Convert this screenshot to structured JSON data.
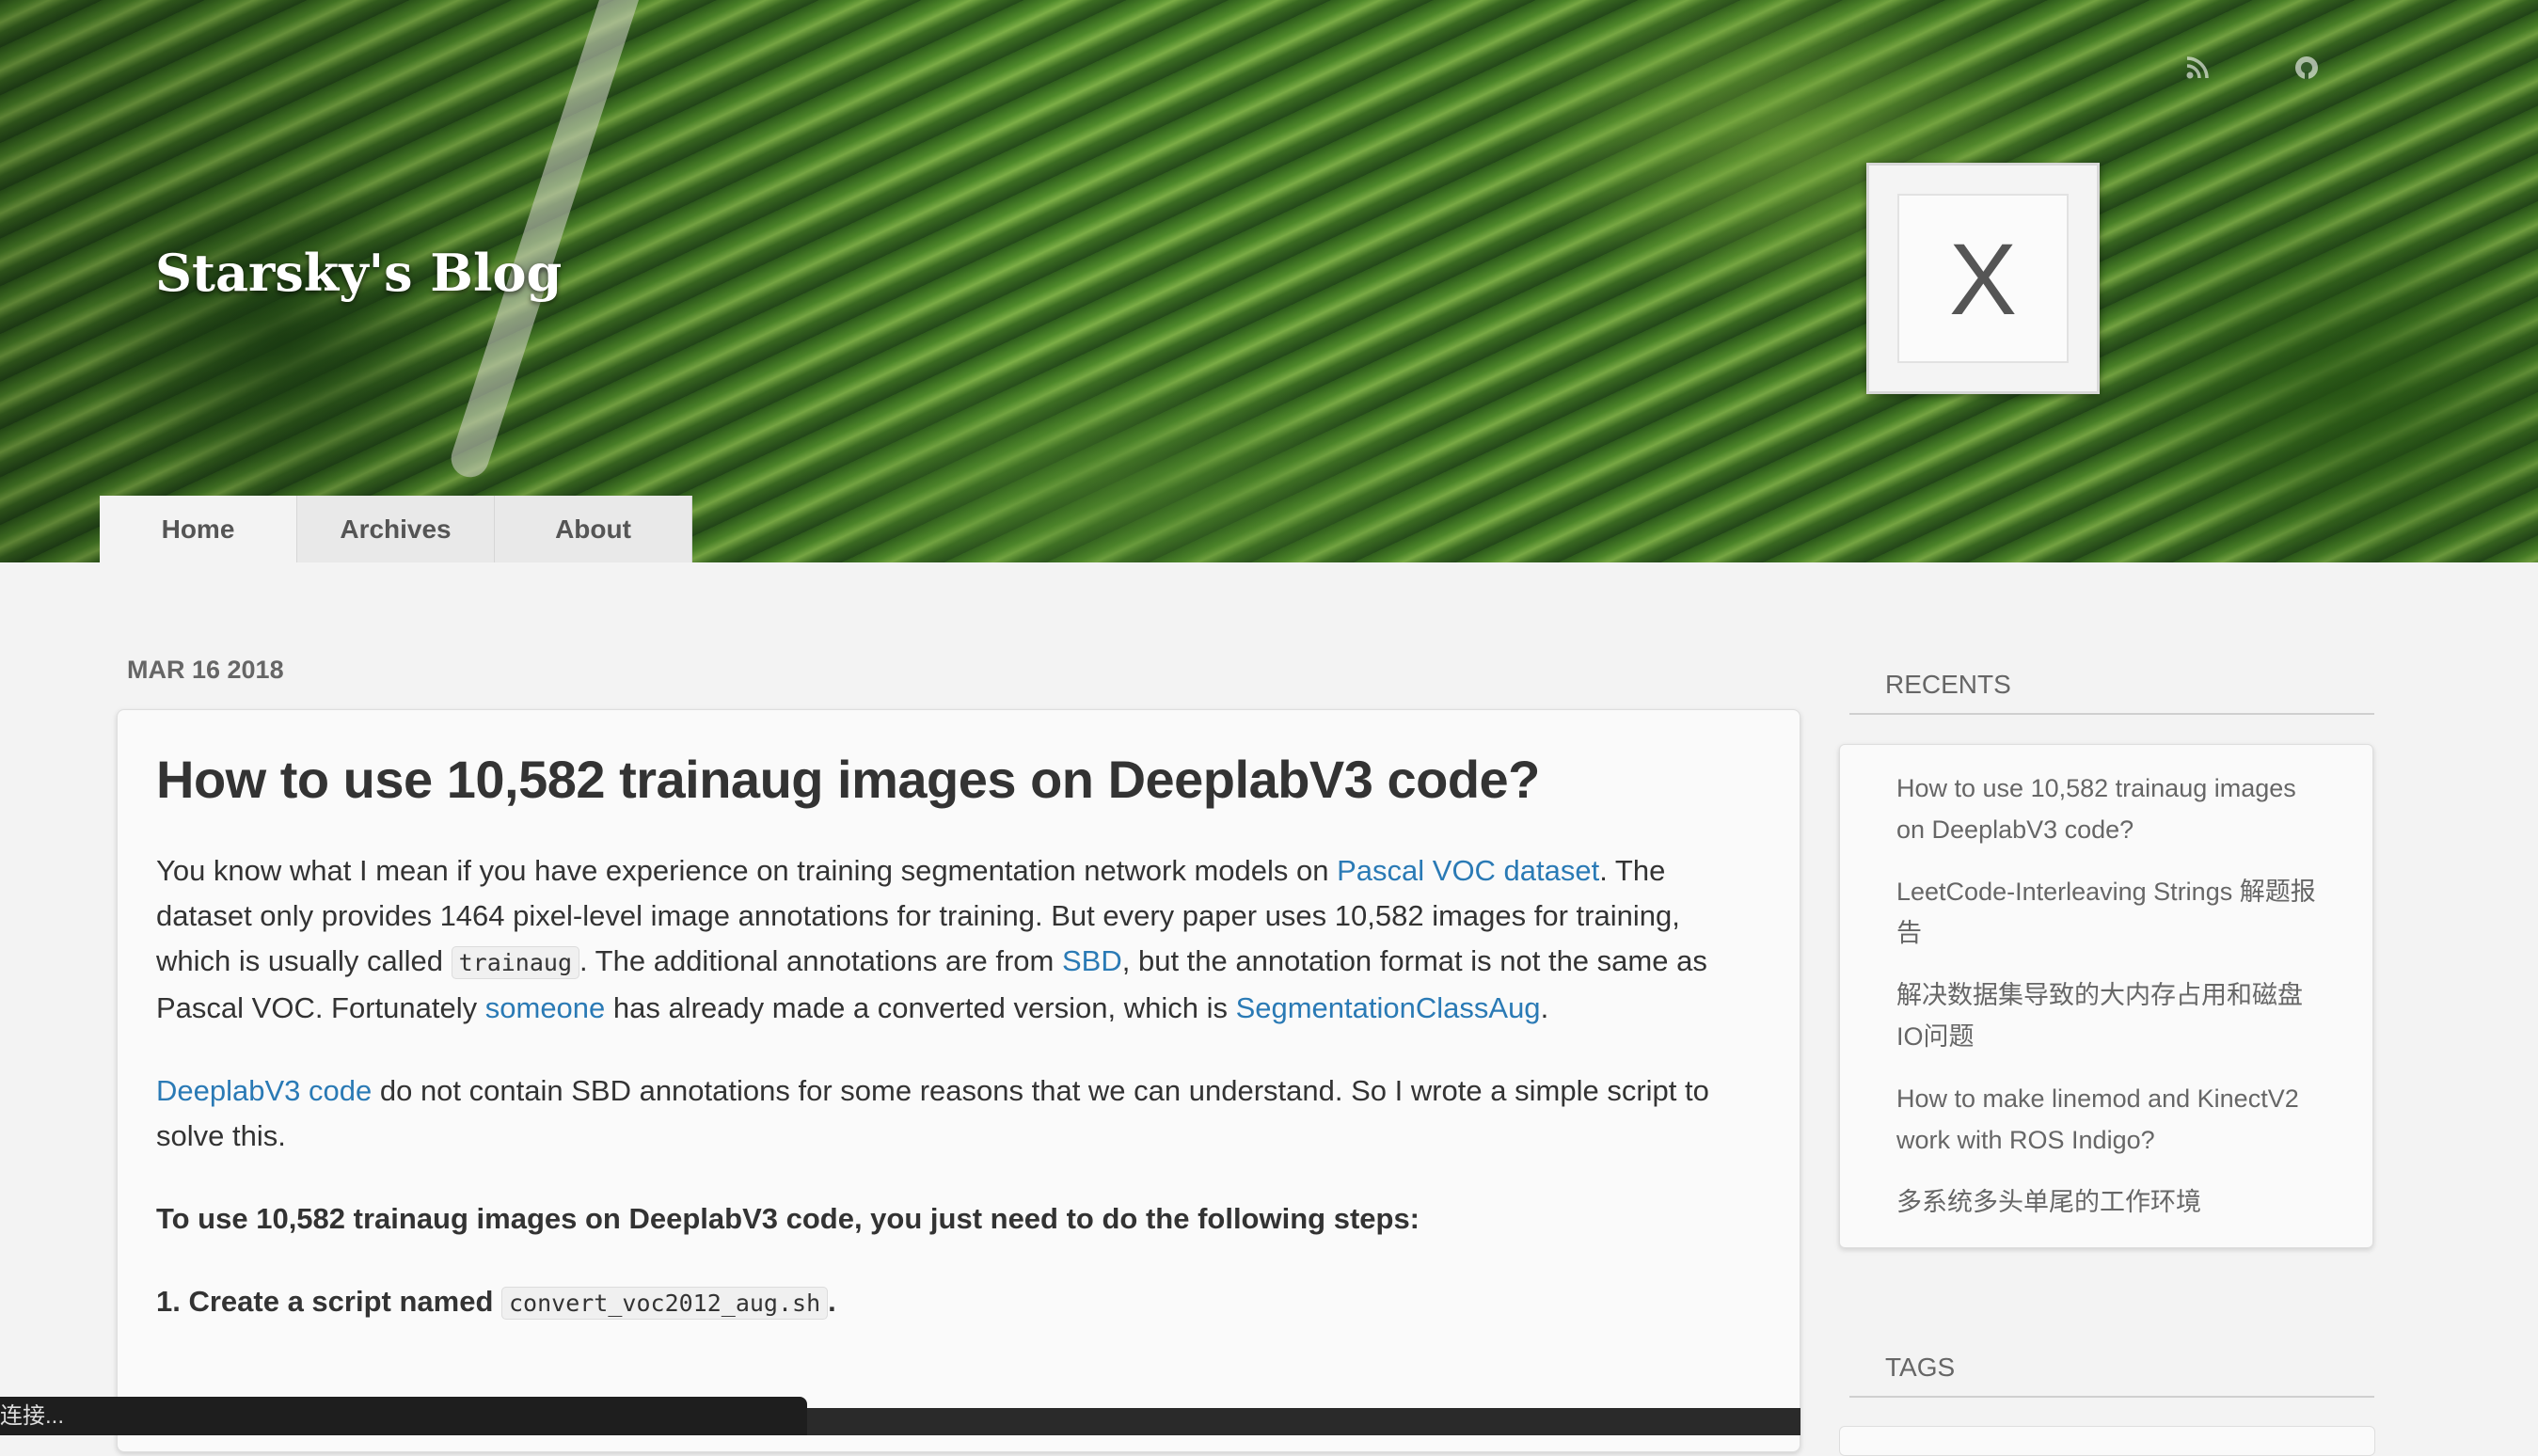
{
  "site": {
    "title": "Starsky's Blog"
  },
  "header_icons": [
    "rss-icon",
    "github-icon"
  ],
  "avatar": {
    "letter": "X"
  },
  "nav": [
    {
      "label": "Home"
    },
    {
      "label": "Archives"
    },
    {
      "label": "About"
    }
  ],
  "post": {
    "date": "MAR 16 2018",
    "title": "How to use 10,582 trainaug images on DeeplabV3 code?",
    "p1": {
      "t1": "You know what I mean if you have experience on training segmentation network models on ",
      "link1": "Pascal VOC dataset",
      "t2": ". The dataset only provides 1464 pixel-level image annotations for training. But every paper uses 10,582 images for training, which is usually called ",
      "code1": "trainaug",
      "t3": ". The additional annotations are from ",
      "link2": "SBD",
      "t4": ", but the annotation format is not the same as Pascal VOC. Fortunately ",
      "link3": "someone",
      "t5": " has already made a converted version, which is ",
      "link4": "SegmentationClassAug",
      "t6": "."
    },
    "p2": {
      "link1": "DeeplabV3 code",
      "t1": " do not contain SBD annotations for some reasons that we can understand. So I wrote a simple script to solve this."
    },
    "p3": "To use 10,582 trainaug images on DeeplabV3 code, you just need to do the following steps:",
    "p4": {
      "t1": "1. Create a script named ",
      "code1": "convert_voc2012_aug.sh",
      "t2": "."
    }
  },
  "sidebar": {
    "recents_heading": "RECENTS",
    "recents": [
      "How to use 10,582 trainaug images on DeeplabV3 code?",
      "LeetCode-Interleaving Strings 解题报告",
      "解决数据集导致的大内存占用和磁盘IO问题",
      "How to make linemod and KinectV2 work with ROS Indigo?",
      "多系统多头单尾的工作环境"
    ],
    "tags_heading": "TAGS"
  },
  "status_bar": {
    "text": "连接..."
  }
}
